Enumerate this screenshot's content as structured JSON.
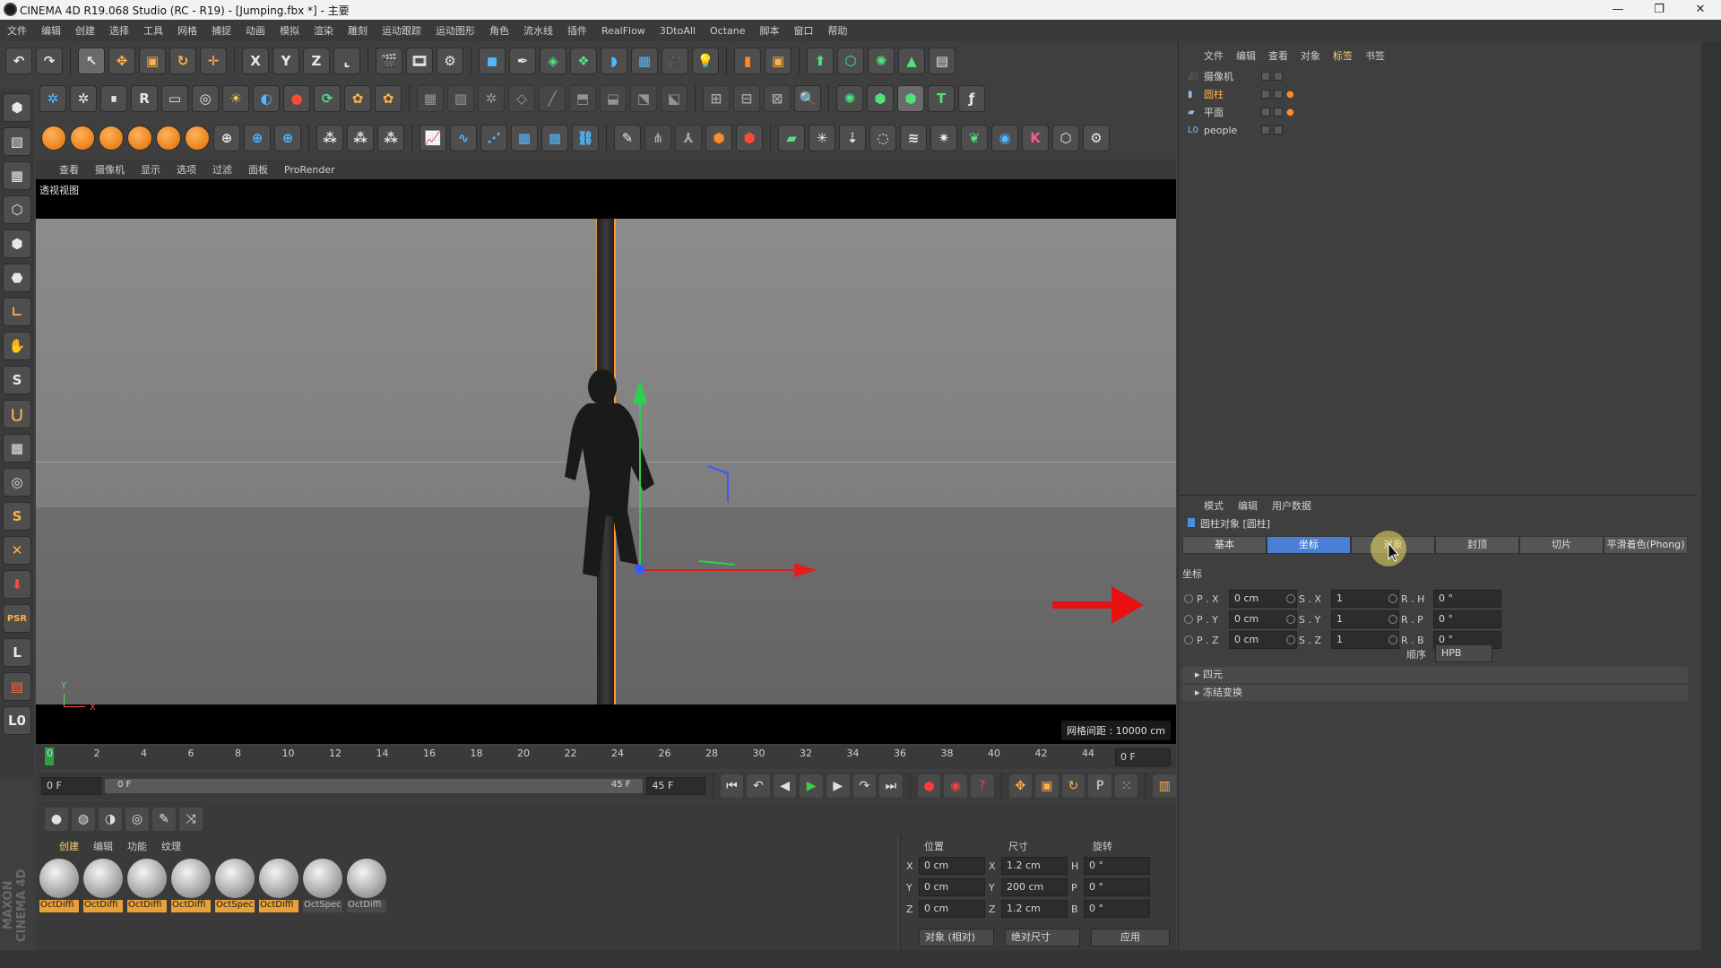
{
  "app": {
    "title": "CINEMA 4D R19.068 Studio (RC - R19) - [Jumping.fbx *] - 主要",
    "window_controls": [
      "—",
      "❐",
      "✕"
    ]
  },
  "menu": [
    "文件",
    "编辑",
    "创建",
    "选择",
    "工具",
    "网格",
    "捕捉",
    "动画",
    "模拟",
    "渲染",
    "雕刻",
    "运动跟踪",
    "运动图形",
    "角色",
    "流水线",
    "插件",
    "RealFlow",
    "3DtoAll",
    "Octane",
    "脚本",
    "窗口",
    "帮助"
  ],
  "toolbar_axes": [
    "X",
    "Y",
    "Z"
  ],
  "viewport": {
    "menu": [
      "查看",
      "摄像机",
      "显示",
      "选项",
      "过滤",
      "面板",
      "ProRender"
    ],
    "label": "透视视图",
    "grid_spacing": "网格间距 : 10000 cm",
    "axis_y": "Y",
    "axis_x": "X"
  },
  "timeline": {
    "ticks": [
      "0",
      "2",
      "4",
      "6",
      "8",
      "10",
      "12",
      "14",
      "16",
      "18",
      "20",
      "22",
      "24",
      "26",
      "28",
      "30",
      "32",
      "34",
      "36",
      "38",
      "40",
      "42",
      "44"
    ],
    "current_frame": "0 F"
  },
  "transport": {
    "start": "0 F",
    "range_start": "0 F",
    "range_end": "45 F",
    "end": "45 F"
  },
  "materials": {
    "menu": [
      "创建",
      "编辑",
      "功能",
      "纹理"
    ],
    "items": [
      {
        "name": "OctDiffi",
        "active": true
      },
      {
        "name": "OctDiffi",
        "active": true
      },
      {
        "name": "OctDiffi",
        "active": true
      },
      {
        "name": "OctDiffi",
        "active": true
      },
      {
        "name": "OctSpec",
        "active": true
      },
      {
        "name": "OctDiffi",
        "active": true
      },
      {
        "name": "OctSpec",
        "active": false
      },
      {
        "name": "OctDiffi",
        "active": false
      }
    ]
  },
  "coords": {
    "headers": [
      "位置",
      "尺寸",
      "旋转"
    ],
    "rows": [
      {
        "a": "X",
        "pos": "0 cm",
        "b": "X",
        "size": "1.2 cm",
        "c": "H",
        "rot": "0 °"
      },
      {
        "a": "Y",
        "pos": "0 cm",
        "b": "Y",
        "size": "200 cm",
        "c": "P",
        "rot": "0 °"
      },
      {
        "a": "Z",
        "pos": "0 cm",
        "b": "Z",
        "size": "1.2 cm",
        "c": "B",
        "rot": "0 °"
      }
    ],
    "mode": "对象 (相对)",
    "size_mode": "绝对尺寸",
    "apply": "应用"
  },
  "objects": {
    "menu": [
      "文件",
      "编辑",
      "查看",
      "对象",
      "标签",
      "书签"
    ],
    "active_menu": "标签",
    "items": [
      {
        "name": "摄像机",
        "selected": false
      },
      {
        "name": "圆柱",
        "selected": true
      },
      {
        "name": "平面",
        "selected": false
      },
      {
        "name": "people",
        "selected": false
      }
    ]
  },
  "attributes": {
    "menu": [
      "模式",
      "编辑",
      "用户数据"
    ],
    "title": "圆柱对象 [圆柱]",
    "tabs": [
      "基本",
      "坐标",
      "对象",
      "封顶",
      "切片",
      "平滑着色(Phong)"
    ],
    "active_tab": "坐标",
    "section": "坐标",
    "rows": [
      {
        "p": "P . X",
        "pv": "0 cm",
        "s": "S . X",
        "sv": "1",
        "r": "R . H",
        "rv": "0 °"
      },
      {
        "p": "P . Y",
        "pv": "0 cm",
        "s": "S . Y",
        "sv": "1",
        "r": "R . P",
        "rv": "0 °"
      },
      {
        "p": "P . Z",
        "pv": "0 cm",
        "s": "S . Z",
        "sv": "1",
        "r": "R . B",
        "rv": "0 °"
      }
    ],
    "order_label": "顺序",
    "order_value": "HPB",
    "groups": [
      "四元",
      "冻结变换"
    ]
  },
  "colors": {
    "accent_orange": "#ff9a2a",
    "tab_active": "#4a7fd4",
    "playhead": "#2ea043",
    "arrow_red": "#e81010"
  }
}
